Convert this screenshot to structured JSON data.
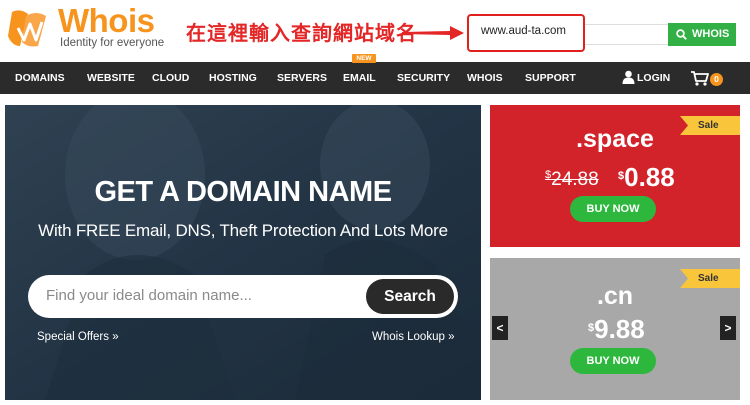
{
  "header": {
    "logo_word": "Whois",
    "logo_tagline": "Identity for everyone",
    "annotation": "在這裡輸入查詢網站域名",
    "whois_input_value": "www.aud-ta.com",
    "whois_button_label": "WHOIS"
  },
  "nav": {
    "items": [
      "DOMAINS",
      "WEBSITE",
      "CLOUD",
      "HOSTING",
      "SERVERS",
      "EMAIL",
      "SECURITY",
      "WHOIS",
      "SUPPORT"
    ],
    "new_badge": "NEW",
    "login_label": "LOGIN",
    "cart_count": "0"
  },
  "hero": {
    "title": "GET A DOMAIN NAME",
    "subtitle": "With FREE Email, DNS, Theft Protection And Lots More",
    "search_placeholder": "Find your ideal domain name...",
    "search_button": "Search",
    "link_left": "Special Offers »",
    "link_right": "Whois Lookup »"
  },
  "promos": [
    {
      "tld": ".space",
      "currency": "$",
      "old_price": "24.88",
      "new_price": "0.88",
      "button": "BUY NOW",
      "ribbon": "Sale",
      "background": "#d3232a"
    },
    {
      "tld": ".cn",
      "currency": "$",
      "new_price": "9.88",
      "button": "BUY NOW",
      "ribbon": "Sale",
      "background": "#a8a8a8"
    }
  ],
  "carousel": {
    "prev": "<",
    "next": ">"
  },
  "colors": {
    "brand_orange": "#f7941d",
    "nav_bg": "#2b2b2b",
    "cta_green": "#32b046",
    "annotation_red": "#e32626"
  },
  "icons": {
    "logo": "whois-logo-icon",
    "search": "search-icon",
    "login": "user-icon",
    "cart": "cart-icon"
  }
}
